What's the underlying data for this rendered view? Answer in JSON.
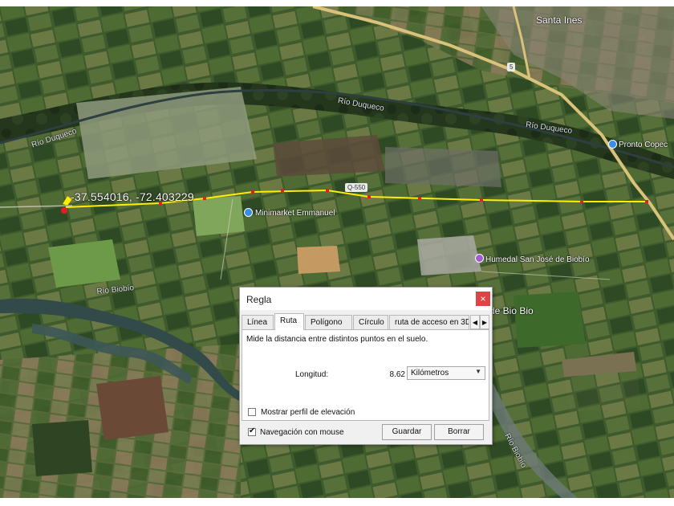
{
  "map": {
    "coordinates": "-37.554016, -72.403229",
    "towns": {
      "santa_ines": "Santa Ines",
      "bio_bio": "de Bio Bio"
    },
    "rivers": {
      "duqueco_west": "Río Duqueco",
      "duqueco_center": "Río Duqueco",
      "duqueco_east": "Río Duqueco",
      "biobio_west": "Río Biobío",
      "biobio_east": "Río Biobío"
    },
    "roads": {
      "q550": "Q-550",
      "route5": "5"
    },
    "pois": {
      "minimarket": "Minimarket Emmanuel",
      "humedal": "Humedal San José de Biobío",
      "copec": "Pronto Copec"
    },
    "colors": {
      "route_line": "#ffee00",
      "highway": "#d9c27a",
      "poi_blue": "#3b8be8",
      "poi_purple": "#a25bd1"
    }
  },
  "dialog": {
    "title": "Regla",
    "close_symbol": "×",
    "tabs": [
      {
        "label": "Línea",
        "active": false
      },
      {
        "label": "Ruta",
        "active": true
      },
      {
        "label": "Polígono",
        "active": false
      },
      {
        "label": "Círculo",
        "active": false
      },
      {
        "label": "ruta de acceso en 3D",
        "active": false
      }
    ],
    "tab_prev_icon": "◀",
    "tab_next_icon": "▶",
    "description": "Mide la distancia entre distintos puntos en el suelo.",
    "length_label": "Longitud:",
    "length_value": "8.62",
    "unit_selected": "Kilómetros",
    "unit_caret": "▼",
    "elevation_checkbox": {
      "label": "Mostrar perfil de elevación",
      "checked": false
    },
    "mouse_nav_checkbox": {
      "label": "Navegación con mouse",
      "checked": true,
      "check_mark": "✔"
    },
    "save_label": "Guardar",
    "clear_label": "Borrar",
    "colors": {
      "close_button": "#e04343"
    }
  }
}
